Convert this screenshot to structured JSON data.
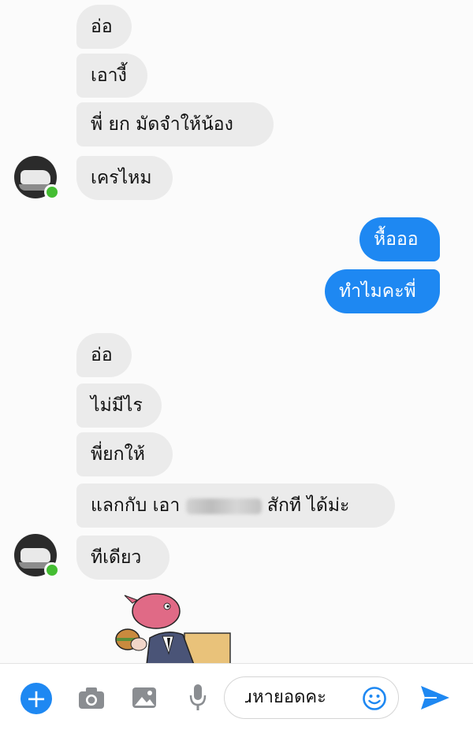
{
  "messages": {
    "group1": [
      "อ่อ",
      "เอางี้",
      "พี่ ยก มัดจำให้น้อง",
      "เครไหม"
    ],
    "outgoing": [
      "หื้อออ",
      "ทำไมคะพี่"
    ],
    "group2": [
      "อ่อ",
      "ไม่มีไร",
      "พี่ยกให้"
    ],
    "trade_prefix": "แลกกับ เอา",
    "trade_suffix": "สักที ได้ม่ะ",
    "last": "ทีเดียว"
  },
  "composer": {
    "input_value": "ɹหายอดคะ"
  },
  "colors": {
    "accent": "#1e88f2",
    "incoming_bubble": "#ebebeb",
    "online": "#44bd32"
  },
  "icons": [
    "plus-icon",
    "camera-icon",
    "gallery-icon",
    "microphone-icon",
    "emoji-icon",
    "send-icon"
  ]
}
